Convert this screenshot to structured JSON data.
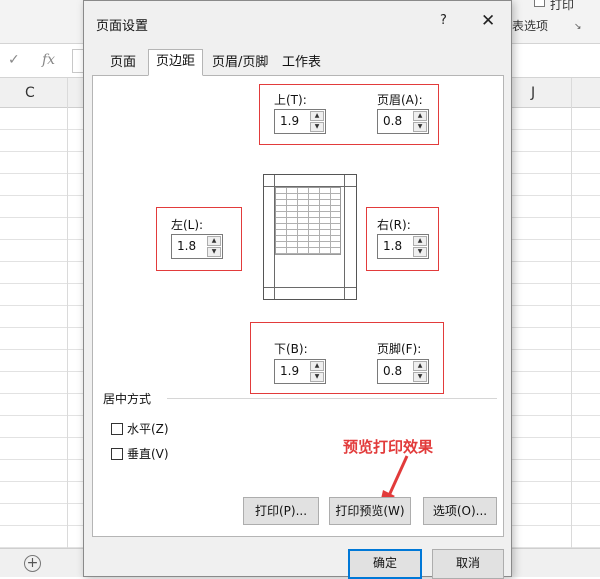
{
  "excel": {
    "ribbon_items": [
      "打印",
      "打印",
      "表选项"
    ],
    "function_icon": "fx",
    "check_icon": "✓",
    "column_headers": [
      "C",
      "J"
    ],
    "add_sheet_icon": "plus-circle-icon"
  },
  "dialog": {
    "title": "页面设置",
    "help_label": "?",
    "close_label": "✕",
    "tabs": [
      {
        "label": "页面"
      },
      {
        "label": "页边距"
      },
      {
        "label": "页眉/页脚"
      },
      {
        "label": "工作表"
      }
    ],
    "active_tab": "页边距",
    "margins": {
      "top": {
        "label": "上(T):",
        "value": "1.9"
      },
      "header": {
        "label": "页眉(A):",
        "value": "0.8"
      },
      "left": {
        "label": "左(L):",
        "value": "1.8"
      },
      "right": {
        "label": "右(R):",
        "value": "1.8"
      },
      "bottom": {
        "label": "下(B):",
        "value": "1.9"
      },
      "footer": {
        "label": "页脚(F):",
        "value": "0.8"
      }
    },
    "center_section": {
      "title": "居中方式",
      "horizontal_label": "水平(Z)",
      "vertical_label": "垂直(V)",
      "horizontal_checked": false,
      "vertical_checked": false
    },
    "annotation": "预览打印效果",
    "buttons": {
      "print": "打印(P)...",
      "print_preview": "打印预览(W)",
      "options": "选项(O)...",
      "ok": "确定",
      "cancel": "取消"
    },
    "colors": {
      "highlight_red": "#e23b3b",
      "primary_blue": "#0078d7"
    }
  }
}
